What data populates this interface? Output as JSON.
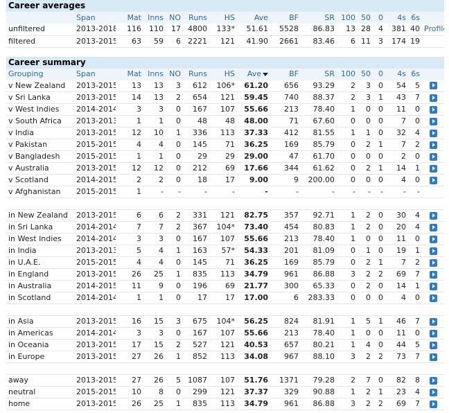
{
  "averages": {
    "title": "Career averages",
    "headers": [
      "",
      "Span",
      "Mat",
      "Inns",
      "NO",
      "Runs",
      "HS",
      "Ave",
      "BF",
      "SR",
      "100",
      "50",
      "0",
      "4s",
      "6s",
      ""
    ],
    "rows": [
      {
        "grouping": "unfiltered",
        "cells": [
          "2013-2018",
          "116",
          "110",
          "17",
          "4800",
          "133*",
          "51.61",
          "5528",
          "86.83",
          "13",
          "28",
          "4",
          "381",
          "40"
        ],
        "link": "Profile"
      },
      {
        "grouping": "filtered",
        "cells": [
          "2013-2015",
          "63",
          "59",
          "6",
          "2221",
          "121",
          "41.90",
          "2661",
          "83.46",
          "6",
          "11",
          "3",
          "174",
          "19"
        ],
        "link": ""
      }
    ]
  },
  "summary": {
    "title": "Career summary",
    "headers": [
      "Grouping",
      "Span",
      "Mat",
      "Inns",
      "NO",
      "Runs",
      "HS",
      "Ave",
      "BF",
      "SR",
      "100",
      "50",
      "0",
      "4s",
      "6s"
    ],
    "groups": [
      [
        {
          "grouping": "v New Zealand",
          "cells": [
            "2013-2015",
            "13",
            "13",
            "3",
            "612",
            "106*",
            "61.20",
            "656",
            "93.29",
            "2",
            "3",
            "0",
            "54",
            "5"
          ],
          "icon": true
        },
        {
          "grouping": "v Sri Lanka",
          "cells": [
            "2013-2015",
            "14",
            "13",
            "2",
            "654",
            "121",
            "59.45",
            "740",
            "88.37",
            "2",
            "3",
            "1",
            "43",
            "7"
          ],
          "icon": true
        },
        {
          "grouping": "v West Indies",
          "cells": [
            "2014-2014",
            "3",
            "3",
            "0",
            "167",
            "107",
            "55.66",
            "213",
            "78.40",
            "1",
            "0",
            "0",
            "11",
            "0"
          ],
          "icon": true
        },
        {
          "grouping": "v South Africa",
          "cells": [
            "2013-2013",
            "1",
            "1",
            "0",
            "48",
            "48",
            "48.00",
            "71",
            "67.60",
            "0",
            "0",
            "0",
            "7",
            "0"
          ],
          "icon": true
        },
        {
          "grouping": "v India",
          "cells": [
            "2013-2015",
            "12",
            "10",
            "1",
            "336",
            "113",
            "37.33",
            "412",
            "81.55",
            "1",
            "1",
            "0",
            "32",
            "4"
          ],
          "icon": true
        },
        {
          "grouping": "v Pakistan",
          "cells": [
            "2015-2015",
            "4",
            "4",
            "0",
            "145",
            "71",
            "36.25",
            "169",
            "85.79",
            "0",
            "2",
            "1",
            "7",
            "2"
          ],
          "icon": true
        },
        {
          "grouping": "v Bangladesh",
          "cells": [
            "2015-2015",
            "1",
            "1",
            "0",
            "29",
            "29",
            "29.00",
            "47",
            "61.70",
            "0",
            "0",
            "0",
            "2",
            "0"
          ],
          "icon": true
        },
        {
          "grouping": "v Australia",
          "cells": [
            "2013-2015",
            "12",
            "12",
            "0",
            "212",
            "69",
            "17.66",
            "344",
            "61.62",
            "0",
            "2",
            "1",
            "14",
            "1"
          ],
          "icon": true
        },
        {
          "grouping": "v Scotland",
          "cells": [
            "2014-2015",
            "2",
            "2",
            "0",
            "18",
            "17",
            "9.00",
            "9",
            "200.00",
            "0",
            "0",
            "0",
            "4",
            "0"
          ],
          "icon": true
        },
        {
          "grouping": "v Afghanistan",
          "cells": [
            "2015-2015",
            "1",
            "-",
            "-",
            "-",
            "-",
            "-",
            "-",
            "-",
            "-",
            "-",
            "-",
            "-",
            "-"
          ],
          "icon": false
        }
      ],
      [
        {
          "grouping": "in New Zealand",
          "cells": [
            "2013-2015",
            "6",
            "6",
            "2",
            "331",
            "121",
            "82.75",
            "357",
            "92.71",
            "1",
            "2",
            "0",
            "30",
            "4"
          ],
          "icon": true
        },
        {
          "grouping": "in Sri Lanka",
          "cells": [
            "2014-2014",
            "7",
            "7",
            "2",
            "367",
            "104*",
            "73.40",
            "454",
            "80.83",
            "1",
            "2",
            "0",
            "20",
            "4"
          ],
          "icon": true
        },
        {
          "grouping": "in West Indies",
          "cells": [
            "2014-2014",
            "3",
            "3",
            "0",
            "167",
            "107",
            "55.66",
            "213",
            "78.40",
            "1",
            "0",
            "0",
            "11",
            "0"
          ],
          "icon": true
        },
        {
          "grouping": "in India",
          "cells": [
            "2013-2013",
            "5",
            "4",
            "1",
            "163",
            "57*",
            "54.33",
            "201",
            "81.09",
            "0",
            "1",
            "0",
            "19",
            "1"
          ],
          "icon": true
        },
        {
          "grouping": "in U.A.E.",
          "cells": [
            "2015-2015",
            "4",
            "4",
            "0",
            "145",
            "71",
            "36.25",
            "169",
            "85.79",
            "0",
            "2",
            "1",
            "7",
            "2"
          ],
          "icon": true
        },
        {
          "grouping": "in England",
          "cells": [
            "2013-2015",
            "26",
            "25",
            "1",
            "835",
            "113",
            "34.79",
            "961",
            "86.88",
            "3",
            "2",
            "2",
            "69",
            "7"
          ],
          "icon": true
        },
        {
          "grouping": "in Australia",
          "cells": [
            "2014-2015",
            "11",
            "9",
            "0",
            "196",
            "69",
            "21.77",
            "300",
            "65.33",
            "0",
            "2",
            "0",
            "14",
            "1"
          ],
          "icon": true
        },
        {
          "grouping": "in Scotland",
          "cells": [
            "2014-2014",
            "1",
            "1",
            "0",
            "17",
            "17",
            "17.00",
            "6",
            "283.33",
            "0",
            "0",
            "0",
            "4",
            "0"
          ],
          "icon": true
        }
      ],
      [
        {
          "grouping": "in Asia",
          "cells": [
            "2013-2015",
            "16",
            "15",
            "3",
            "675",
            "104*",
            "56.25",
            "824",
            "81.91",
            "1",
            "5",
            "1",
            "46",
            "7"
          ],
          "icon": true
        },
        {
          "grouping": "in Americas",
          "cells": [
            "2014-2014",
            "3",
            "3",
            "0",
            "167",
            "107",
            "55.66",
            "213",
            "78.40",
            "1",
            "0",
            "0",
            "11",
            "0"
          ],
          "icon": true
        },
        {
          "grouping": "in Oceania",
          "cells": [
            "2013-2015",
            "17",
            "15",
            "2",
            "527",
            "121",
            "40.53",
            "657",
            "80.21",
            "1",
            "4",
            "0",
            "44",
            "5"
          ],
          "icon": true
        },
        {
          "grouping": "in Europe",
          "cells": [
            "2013-2015",
            "27",
            "26",
            "1",
            "852",
            "113",
            "34.08",
            "967",
            "88.10",
            "3",
            "2",
            "2",
            "73",
            "7"
          ],
          "icon": true
        }
      ],
      [
        {
          "grouping": "away",
          "cells": [
            "2013-2015",
            "27",
            "26",
            "5",
            "1087",
            "107",
            "51.76",
            "1371",
            "79.28",
            "2",
            "7",
            "0",
            "82",
            "8"
          ],
          "icon": true
        },
        {
          "grouping": "neutral",
          "cells": [
            "2015-2015",
            "10",
            "8",
            "0",
            "299",
            "121",
            "37.37",
            "329",
            "90.88",
            "1",
            "2",
            "1",
            "23",
            "4"
          ],
          "icon": true
        },
        {
          "grouping": "home",
          "cells": [
            "2013-2015",
            "26",
            "25",
            "1",
            "835",
            "113",
            "34.79",
            "961",
            "86.88",
            "3",
            "2",
            "2",
            "69",
            "7"
          ],
          "icon": true
        }
      ]
    ]
  },
  "colors": {
    "header_bg": "#d9eaf7",
    "link": "#2a6aa8",
    "icon": "#2e7bc4"
  }
}
